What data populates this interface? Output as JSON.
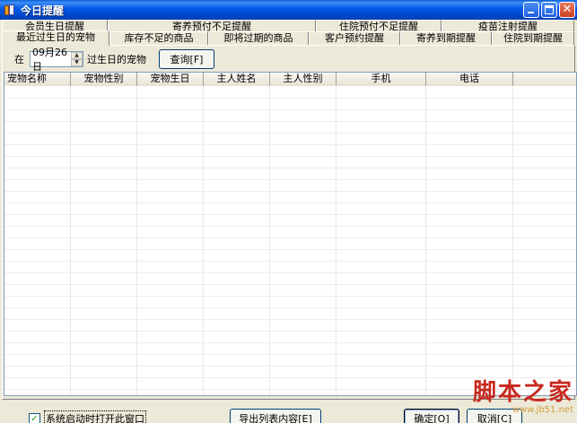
{
  "window": {
    "title": "今日提醒",
    "icon": "app-icon",
    "controls": {
      "minimize": "minimize-icon",
      "maximize": "maximize-icon",
      "close": "close-icon",
      "close_glyph": "✕"
    }
  },
  "tabs": {
    "back_row": [
      "会员生日提醒",
      "寄养预付不足提醒",
      "住院预付不足提醒",
      "疫苗注射提醒"
    ],
    "front_row": [
      "最近过生日的宠物",
      "库存不足的商品",
      "即将过期的商品",
      "客户预约提醒",
      "寄养到期提醒",
      "住院到期提醒"
    ],
    "active": "最近过生日的宠物"
  },
  "query": {
    "prefix": "在",
    "date_value": "09月26日",
    "suffix": "过生日的宠物",
    "button": "查询[F]",
    "spin_up": "▲",
    "spin_down": "▼"
  },
  "grid": {
    "columns": [
      "宠物名称",
      "宠物性别",
      "宠物生日",
      "主人姓名",
      "主人性别",
      "手机",
      "电话"
    ],
    "rows": []
  },
  "footer": {
    "checkbox_label": "系统启动时打开此窗口",
    "checkbox_checked": true,
    "checkbox_mark": "✓",
    "export_button": "导出列表内容[E]",
    "ok_button": "确定[O]",
    "cancel_button": "取消[C]"
  },
  "watermark": {
    "text": "脚本之家",
    "url": "www.jb51.net"
  },
  "colors": {
    "titlebar": "#0058e6",
    "face": "#ece9d8",
    "watermark": "#c8281e"
  }
}
